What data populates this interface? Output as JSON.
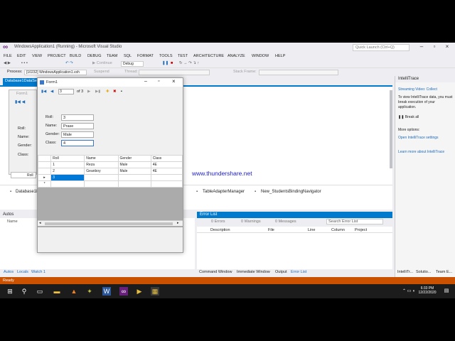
{
  "app": {
    "title": "WindowsApplication1 (Running) - Microsoft Visual Studio",
    "quick_launch": "Quick Launch (Ctrl+Q)"
  },
  "menu": [
    "FILE",
    "EDIT",
    "VIEW",
    "PROJECT",
    "BUILD",
    "DEBUG",
    "TEAM",
    "SQL",
    "FORMAT",
    "TOOLS",
    "TEST",
    "ARCHITECTURE",
    "ANALYZE",
    "WINDOW",
    "HELP"
  ],
  "toolbar": {
    "continue": "Continue",
    "config": "Debug",
    "process_label": "Process:",
    "process_value": "[10232] WindowsApplication1.vsh",
    "suspend": "Suspend",
    "thread": "Thread:",
    "stack_frame": "Stack Frame:"
  },
  "doc_tab": "Database1DataSe",
  "designer": {
    "form_title": "Form1",
    "labels": [
      "Roll:",
      "Name:",
      "Gender:",
      "Class:"
    ],
    "grid_col": "Roll"
  },
  "tray": {
    "items": [
      "Database1D",
      "TableAdapterManager",
      "New_StudentsBindingNavigator"
    ]
  },
  "watermark": "www.thundershare.net",
  "form1": {
    "title": "Form1",
    "nav_position": "3",
    "nav_of": "of 3",
    "fields": [
      {
        "label": "Roll:",
        "value": "3"
      },
      {
        "label": "Name:",
        "value": "Prase"
      },
      {
        "label": "Gender:",
        "value": "Male"
      },
      {
        "label": "Class:",
        "value": "4"
      }
    ],
    "grid": {
      "headers": [
        "Roll",
        "Name",
        "Gender",
        "Class"
      ],
      "rows": [
        [
          "1",
          "Reza",
          "Male",
          "4E"
        ],
        [
          "2",
          "Geanboy",
          "Male",
          "4E"
        ],
        [
          "3",
          "",
          "",
          ""
        ]
      ]
    }
  },
  "autos": {
    "title": "Autos",
    "col_name": "Name",
    "tabs": [
      "Autos",
      "Locals",
      "Watch 1"
    ]
  },
  "error_list": {
    "title": "Error List",
    "errors": "0 Errors",
    "warnings": "0 Warnings",
    "messages": "0 Messages",
    "search": "Search Error List",
    "columns": [
      "Description",
      "File",
      "Line",
      "Column",
      "Project"
    ],
    "tabs": [
      "Command Window",
      "Immediate Window",
      "Output",
      "Error List"
    ]
  },
  "intellitrace": {
    "title": "IntelliTrace",
    "streaming": "Streaming Video: Collect",
    "desc": "To view IntelliTrace data, you must break execution of your application.",
    "break_all": "Break all",
    "more_options": "More options:",
    "settings_link": "Open IntelliTrace settings",
    "learn_link": "Learn more about IntelliTrace",
    "tabs": [
      "IntelliTr...",
      "Solutio...",
      "Team E..."
    ]
  },
  "status": "Ready",
  "taskbar": {
    "time": "6:33 PM",
    "date": "12/22/2020"
  },
  "colors": {
    "accent": "#007acc",
    "status_bar": "#ca5100",
    "link": "#1c1cc9"
  }
}
